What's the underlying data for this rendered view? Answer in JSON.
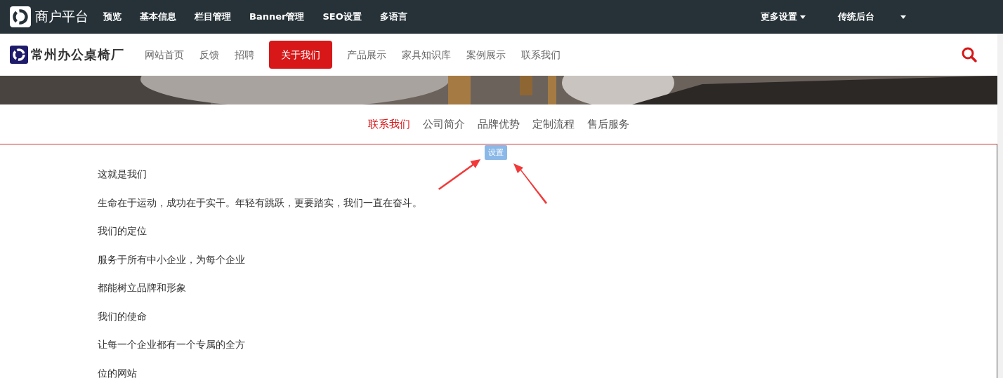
{
  "admin_bar": {
    "title": "商户平台",
    "menu": [
      {
        "label": "预览"
      },
      {
        "label": "基本信息"
      },
      {
        "label": "栏目管理"
      },
      {
        "label": "Banner管理"
      },
      {
        "label": "SEO设置"
      },
      {
        "label": "多语言"
      }
    ],
    "right_menu": [
      {
        "label": "更多设置",
        "dropdown": true
      },
      {
        "label": "传统后台",
        "dropdown": false
      }
    ]
  },
  "site_header": {
    "logo_text": "常州办公桌椅厂",
    "nav": [
      {
        "label": "网站首页",
        "selected": false
      },
      {
        "label": "反馈",
        "selected": false
      },
      {
        "label": "招聘",
        "selected": false
      },
      {
        "label": "关于我们",
        "selected": true
      },
      {
        "label": "产品展示",
        "selected": false
      },
      {
        "label": "家具知识库",
        "selected": false
      },
      {
        "label": "案例展示",
        "selected": false
      },
      {
        "label": "联系我们",
        "selected": false
      }
    ]
  },
  "sub_tabs": [
    {
      "label": "联系我们",
      "selected": true
    },
    {
      "label": "公司简介",
      "selected": false
    },
    {
      "label": "品牌优势",
      "selected": false
    },
    {
      "label": "定制流程",
      "selected": false
    },
    {
      "label": "售后服务",
      "selected": false
    }
  ],
  "settings_badge": "设置",
  "content": [
    "这就是我们",
    "生命在于运动，成功在于实干。年轻有跳跃，更要踏实，我们一直在奋斗。",
    "我们的定位",
    "服务于所有中小企业，为每个企业",
    "都能树立品牌和形象",
    "我们的使命",
    "让每一个企业都有一个专属的全方",
    "位的网站"
  ]
}
